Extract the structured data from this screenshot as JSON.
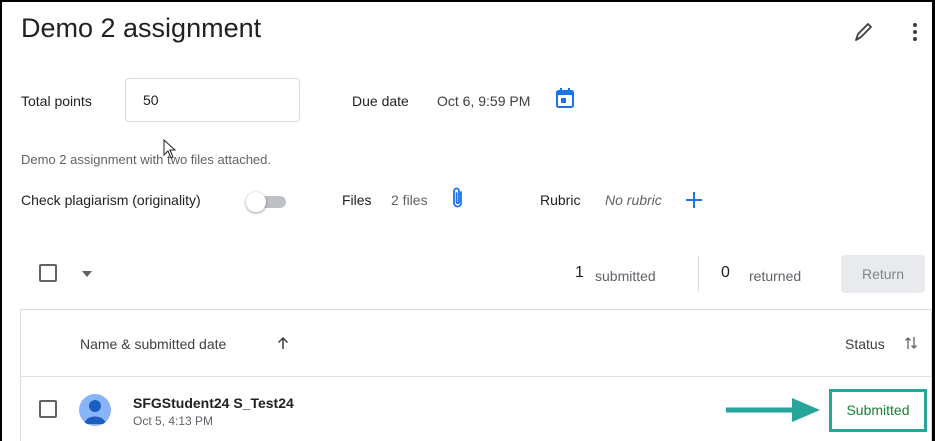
{
  "assignment": {
    "title": "Demo 2 assignment",
    "total_points_label": "Total points",
    "total_points_value": "50",
    "due_date_label": "Due date",
    "due_date_value": "Oct 6, 9:59 PM",
    "description": "Demo 2 assignment with two files attached.",
    "plagiarism_label": "Check plagiarism (originality)",
    "plagiarism_enabled": false,
    "files_label": "Files",
    "files_value": "2 files",
    "rubric_label": "Rubric",
    "rubric_value": "No rubric"
  },
  "toolbar": {
    "submitted_count": "1",
    "submitted_label": "submitted",
    "returned_count": "0",
    "returned_label": "returned",
    "return_button": "Return"
  },
  "table": {
    "col_name": "Name & submitted date",
    "col_status": "Status",
    "rows": [
      {
        "name": "SFGStudent24 S_Test24",
        "date": "Oct 5, 4:13 PM",
        "status": "Submitted"
      }
    ]
  },
  "icons": {
    "edit": "pencil-icon",
    "more": "more-vert-icon",
    "calendar": "calendar-icon",
    "attachment": "paperclip-icon",
    "add": "plus-icon",
    "sort_asc": "arrow-up-icon",
    "sort": "sort-icon",
    "avatar": "person-icon"
  },
  "colors": {
    "accent": "#1a73e8",
    "submitted_text": "#188038",
    "highlight": "#26a69a"
  }
}
